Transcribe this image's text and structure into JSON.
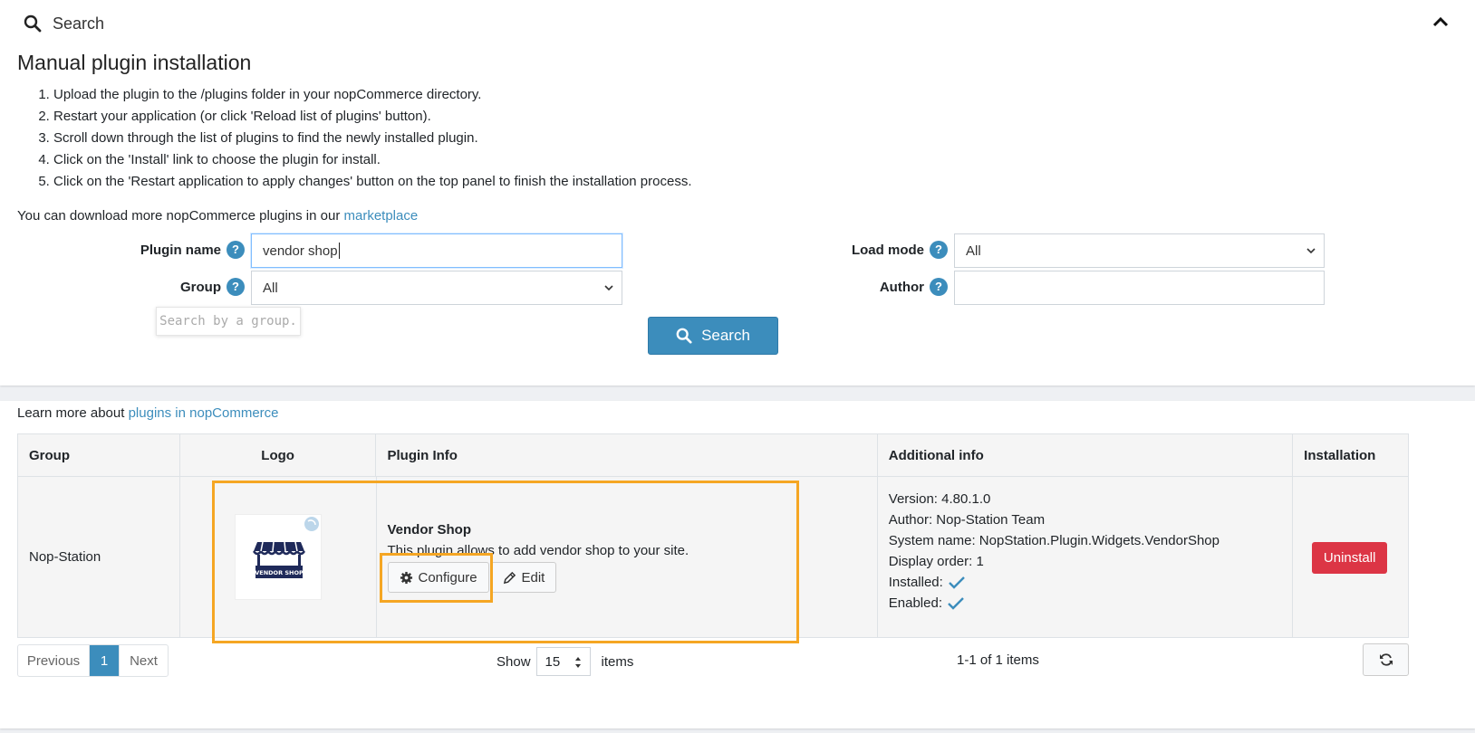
{
  "search_panel": {
    "title": "Search",
    "heading": "Manual plugin installation",
    "steps": [
      "Upload the plugin to the /plugins folder in your nopCommerce directory.",
      "Restart your application (or click 'Reload list of plugins' button).",
      "Scroll down through the list of plugins to find the newly installed plugin.",
      "Click on the 'Install' link to choose the plugin for install.",
      "Click on the 'Restart application to apply changes' button on the top panel to finish the installation process."
    ],
    "download_text": "You can download more nopCommerce plugins in our",
    "download_link": "marketplace",
    "help_glyph": "?"
  },
  "filters": {
    "plugin_name_label": "Plugin name",
    "plugin_name_value": "vendor shop",
    "group_label": "Group",
    "group_value": "All",
    "group_tooltip": "Search by a group.",
    "load_mode_label": "Load mode",
    "load_mode_value": "All",
    "author_label": "Author",
    "author_value": "",
    "search_button": "Search"
  },
  "plugins": {
    "learn_text": "Learn more about",
    "learn_link": "plugins in nopCommerce",
    "columns": [
      "Group",
      "Logo",
      "Plugin Info",
      "Additional info",
      "Installation"
    ],
    "row": {
      "group": "Nop-Station",
      "logo_text": "VENDOR SHOP",
      "name": "Vendor Shop",
      "description": "This plugin allows to add vendor shop to your site.",
      "configure_label": "Configure",
      "edit_label": "Edit",
      "version": "Version: 4.80.1.0",
      "author": "Author: Nop-Station Team",
      "system_name": "System name: NopStation.Plugin.Widgets.VendorShop",
      "display_order": "Display order: 1",
      "installed": "Installed:",
      "enabled": "Enabled:",
      "uninstall_label": "Uninstall"
    }
  },
  "pager": {
    "previous": "Previous",
    "current_page": "1",
    "next": "Next",
    "show": "Show",
    "page_size": "15",
    "items": "items",
    "count": "1-1 of 1 items"
  },
  "colors": {
    "accent": "#3c8dbc",
    "danger": "#dc3545",
    "highlight": "#f5a623"
  }
}
